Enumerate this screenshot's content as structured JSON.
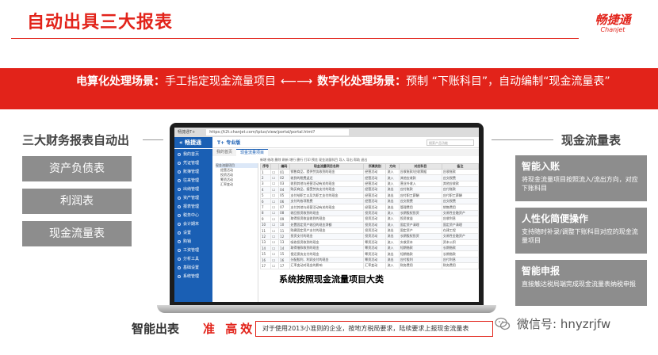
{
  "header": {
    "title": "自动出具三大报表",
    "logo_main": "畅捷通",
    "logo_sub": "Chanjet"
  },
  "banner": {
    "part1_label": "电算化处理场景：",
    "part1_text": "手工指定现金流量项目",
    "arrow": "⟵⟶",
    "part2_label": "数字化处理场景：",
    "part2_text": "预制 “下账科目”，自动编制“现金流量表”"
  },
  "left": {
    "heading": "三大财务报表自动出",
    "items": [
      "资产负债表",
      "利润表",
      "现金流量表"
    ]
  },
  "right": {
    "heading": "现金流量表",
    "features": [
      {
        "title": "智能入账",
        "desc": "将现金流量项目按照流入/流出方向，对应下账科目"
      },
      {
        "title": "人性化简便操作",
        "desc": "支持随时补录/调整下账科目对应的现金流量项目"
      },
      {
        "title": "智能申报",
        "desc": "直接触达税局端完成现金流量表纳税申报"
      }
    ]
  },
  "screen": {
    "browser_title": "畅捷通T+",
    "url": "https://t2t.chanjet.com/tplus/view/portal/portal.html?t=1609750765873",
    "logo": "« 畅捷通",
    "brand": "T+ 专业版",
    "search_placeholder": "搜索产品功能",
    "sidebar": [
      "我的首页",
      "凭证管理",
      "账簿管理",
      "往来管理",
      "出纳管理",
      "资产管理",
      "报表管理",
      "税务中心",
      "会计期末",
      "设置",
      "购销",
      "工资管理",
      "分析工具",
      "基础设置",
      "系统管理"
    ],
    "tabs": [
      "我的首页",
      "现金流量项目"
    ],
    "toolbar": "新增  修改  删除  刷新  增行  删行  打印  预览  现金流量科目  导入  导出  帮助  退出",
    "tree": [
      "现金流量项目",
      "经营活动",
      "投资活动",
      "筹资活动",
      "汇率变动"
    ],
    "columns": [
      "序号",
      "",
      "编码",
      "现金流量项目名称",
      "所属类别",
      "方向",
      "对应科目",
      "备注"
    ],
    "rows": [
      [
        "1",
        "☐",
        "01",
        "销售商品、提供劳务收到的现金",
        "经营活动",
        "流入",
        "应收账款/应收票据",
        "应收账款"
      ],
      [
        "2",
        "☐",
        "02",
        "收到的税费返还",
        "经营活动",
        "流入",
        "其他应收款",
        "应交税费"
      ],
      [
        "3",
        "☐",
        "03",
        "收到其他与经营活动有关的现金",
        "经营活动",
        "流入",
        "营业外收入",
        "其他应收款"
      ],
      [
        "4",
        "☐",
        "04",
        "购买商品、接受劳务支付的现金",
        "经营活动",
        "流出",
        "应付账款",
        "应付账款"
      ],
      [
        "5",
        "☐",
        "05",
        "支付给职工以及为职工支付的现金",
        "经营活动",
        "流出",
        "应付职工薪酬",
        "应付职工薪酬"
      ],
      [
        "6",
        "☐",
        "06",
        "支付的各项税费",
        "经营活动",
        "流出",
        "应交税费",
        "应交税费"
      ],
      [
        "7",
        "☐",
        "07",
        "支付其他与经营活动有关的现金",
        "经营活动",
        "流出",
        "管理费用",
        "销售费用"
      ],
      [
        "8",
        "☐",
        "08",
        "收回投资收到的现金",
        "投资活动",
        "流入",
        "长期股权投资",
        "交易性金融资产"
      ],
      [
        "9",
        "☐",
        "09",
        "取得投资收益收到的现金",
        "投资活动",
        "流入",
        "投资收益",
        "应收利息"
      ],
      [
        "10",
        "☐",
        "10",
        "处置固定资产收回的现金净额",
        "投资活动",
        "流入",
        "固定资产清理",
        "固定资产清理"
      ],
      [
        "11",
        "☐",
        "11",
        "购建固定资产支付的现金",
        "投资活动",
        "流出",
        "固定资产",
        "在建工程"
      ],
      [
        "12",
        "☐",
        "12",
        "投资支付的现金",
        "投资活动",
        "流出",
        "长期股权投资",
        "交易性金融资产"
      ],
      [
        "13",
        "☐",
        "13",
        "吸收投资收到的现金",
        "筹资活动",
        "流入",
        "实收资本",
        "资本公积"
      ],
      [
        "14",
        "☐",
        "14",
        "取得借款收到的现金",
        "筹资活动",
        "流入",
        "短期借款",
        "长期借款"
      ],
      [
        "15",
        "☐",
        "15",
        "偿还债务支付的现金",
        "筹资活动",
        "流出",
        "短期借款",
        "长期借款"
      ],
      [
        "16",
        "☐",
        "16",
        "分配股利、利润支付的现金",
        "筹资活动",
        "流出",
        "应付股利",
        "应付利息"
      ],
      [
        "17",
        "☐",
        "17",
        "汇率变动对现金的影响",
        "汇率变动",
        "流入",
        "财务费用",
        "财务费用"
      ]
    ],
    "caption": "系统按照现金流量项目大类"
  },
  "bottom": {
    "smart": "智能出表",
    "accurate": "准 高效",
    "note": "对于使用2013小准则的企业，按地方税局要求，陆续要求上报现金流量表",
    "wechat": "微信号: hnyzrjfw"
  }
}
